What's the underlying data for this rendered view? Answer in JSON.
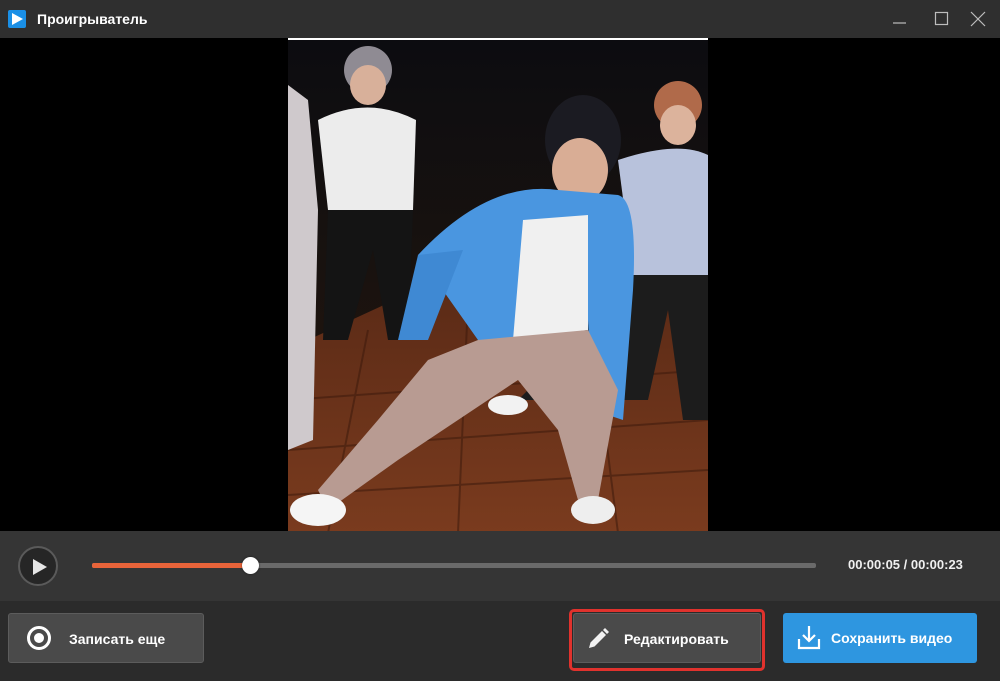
{
  "window": {
    "title": "Проигрыватель",
    "icon": "play-logo-icon",
    "accent": "#1a8fe6"
  },
  "player": {
    "progress_fraction": 0.218,
    "progress_color": "#e8643a",
    "time_current": "00:00:05",
    "time_total": "00:00:23",
    "time_display": "00:00:05 / 00:00:23"
  },
  "actions": {
    "record_label": "Записать еще",
    "edit_label": "Редактировать",
    "save_label": "Сохранить видео",
    "save_color": "#2e96e0",
    "highlight_color": "#e0322d"
  }
}
